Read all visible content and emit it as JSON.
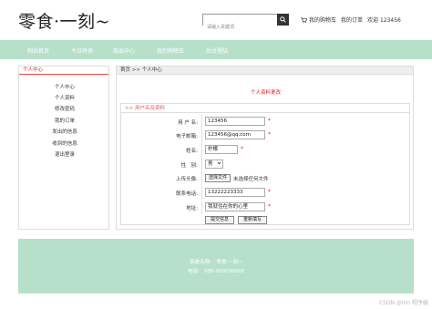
{
  "header": {
    "logo": "零食·一刻~",
    "search_placeholder": "请输入关键词",
    "cart_label": "我的购物车",
    "orders_label": "我的订单",
    "welcome_label": "欢迎 123456"
  },
  "nav": {
    "items": [
      "网站首页",
      "今日特卖",
      "商品中心",
      "我的购物车",
      "后台登陆"
    ]
  },
  "sidebar": {
    "title": "个人中心",
    "items": [
      "个人中心",
      "个人资料",
      "修改密码",
      "我的订单",
      "发出的信息",
      "收到的信息",
      "退出登录"
    ]
  },
  "main": {
    "breadcrumb": "首页 >> 个人中心",
    "title": "个人资料更改",
    "form_header": ">> 用户名及资料",
    "fields": {
      "username_label": "用 户 名:",
      "username_value": "123456",
      "email_label": "电子邮箱:",
      "email_value": "123456@qq.com",
      "name_label": "姓名:",
      "name_value": "柠檬",
      "gender_label": "性　别:",
      "gender_value": "男",
      "avatar_label": "上传头像:",
      "avatar_button": "选择文件",
      "avatar_status": "未选择任何文件",
      "phone_label": "联系电话:",
      "phone_value": "13222223333",
      "address_label": "地址:",
      "address_value": "我就住在你的心里"
    },
    "submit_label": "提交信息",
    "reset_label": "重新填写",
    "required_mark": "*"
  },
  "footer": {
    "line1": "系统名称:　零食·一刻~",
    "line2": "电话:　000-000000000"
  },
  "watermark": "CSDN @lim 程序媛",
  "colors": {
    "accent_green": "#b7e0cb",
    "accent_red": "#dd2222"
  }
}
